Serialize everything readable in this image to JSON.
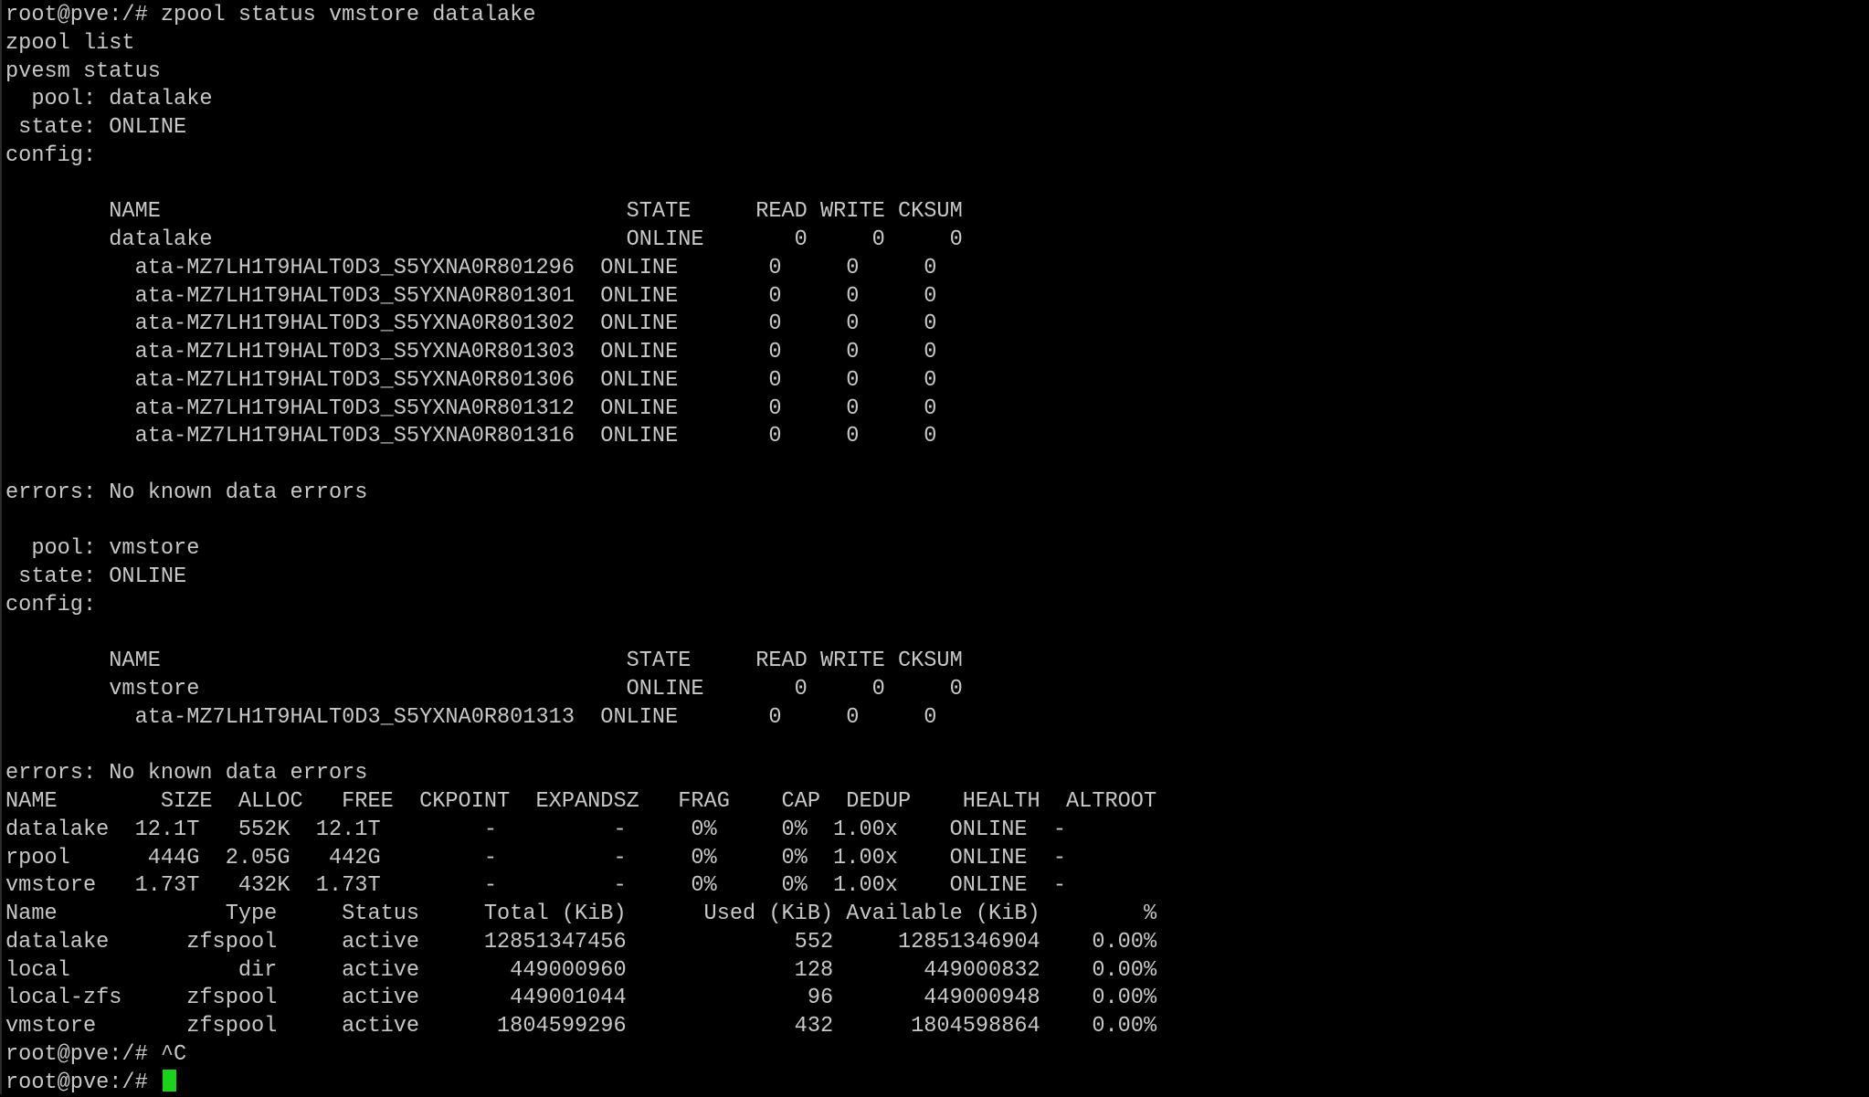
{
  "terminal": {
    "prompt": "root@pve:/# ",
    "lines": [
      "root@pve:/# zpool status vmstore datalake",
      "zpool list",
      "pvesm status",
      "  pool: datalake",
      " state: ONLINE",
      "config:",
      "",
      "        NAME                                    STATE     READ WRITE CKSUM",
      "        datalake                                ONLINE       0     0     0",
      "          ata-MZ7LH1T9HALT0D3_S5YXNA0R801296  ONLINE       0     0     0",
      "          ata-MZ7LH1T9HALT0D3_S5YXNA0R801301  ONLINE       0     0     0",
      "          ata-MZ7LH1T9HALT0D3_S5YXNA0R801302  ONLINE       0     0     0",
      "          ata-MZ7LH1T9HALT0D3_S5YXNA0R801303  ONLINE       0     0     0",
      "          ata-MZ7LH1T9HALT0D3_S5YXNA0R801306  ONLINE       0     0     0",
      "          ata-MZ7LH1T9HALT0D3_S5YXNA0R801312  ONLINE       0     0     0",
      "          ata-MZ7LH1T9HALT0D3_S5YXNA0R801316  ONLINE       0     0     0",
      "",
      "errors: No known data errors",
      "",
      "  pool: vmstore",
      " state: ONLINE",
      "config:",
      "",
      "        NAME                                    STATE     READ WRITE CKSUM",
      "        vmstore                                 ONLINE       0     0     0",
      "          ata-MZ7LH1T9HALT0D3_S5YXNA0R801313  ONLINE       0     0     0",
      "",
      "errors: No known data errors",
      "NAME        SIZE  ALLOC   FREE  CKPOINT  EXPANDSZ   FRAG    CAP  DEDUP    HEALTH  ALTROOT",
      "datalake  12.1T   552K  12.1T        -         -     0%     0%  1.00x    ONLINE  -",
      "rpool      444G  2.05G   442G        -         -     0%     0%  1.00x    ONLINE  -",
      "vmstore   1.73T   432K  1.73T        -         -     0%     0%  1.00x    ONLINE  -",
      "Name             Type     Status     Total (KiB)      Used (KiB) Available (KiB)        %",
      "datalake      zfspool     active     12851347456             552     12851346904    0.00%",
      "local             dir     active       449000960             128       449000832    0.00%",
      "local-zfs     zfspool     active       449001044              96       449000948    0.00%",
      "vmstore       zfspool     active      1804599296             432      1804598864    0.00%",
      "root@pve:/# ^C"
    ]
  },
  "colors": {
    "background": "#000000",
    "text": "#c8c8c8",
    "cursor": "#1ad31a"
  }
}
